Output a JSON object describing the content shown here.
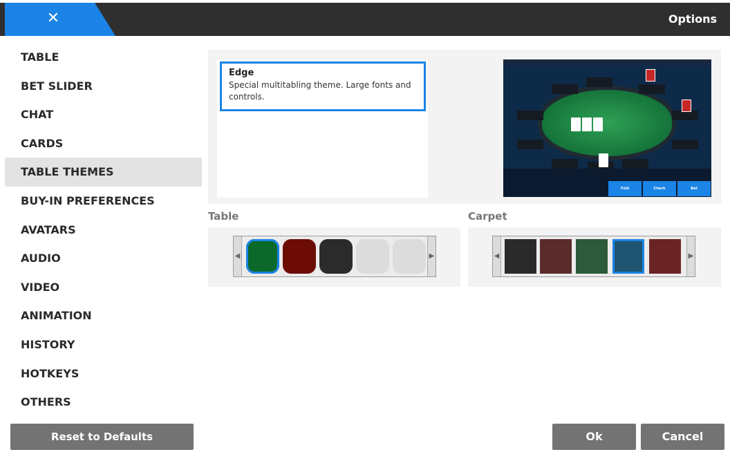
{
  "header": {
    "close_label": "✕",
    "title": "Options"
  },
  "sidebar": {
    "items": [
      {
        "label": "TABLE"
      },
      {
        "label": "BET SLIDER"
      },
      {
        "label": "CHAT"
      },
      {
        "label": "CARDS"
      },
      {
        "label": "TABLE THEMES",
        "active": true
      },
      {
        "label": "BUY-IN PREFERENCES"
      },
      {
        "label": "AVATARS"
      },
      {
        "label": "AUDIO"
      },
      {
        "label": "VIDEO"
      },
      {
        "label": "ANIMATION"
      },
      {
        "label": "HISTORY"
      },
      {
        "label": "HOTKEYS"
      },
      {
        "label": "OTHERS"
      }
    ],
    "reset_label": "Reset to Defaults"
  },
  "themes": {
    "selected": {
      "name": "Edge",
      "description": "Special multitabling theme. Large fonts and controls."
    }
  },
  "preview": {
    "buttons": [
      "Fold",
      "Check",
      "Bet"
    ]
  },
  "table_picker": {
    "label": "Table",
    "swatches": [
      "#0b6a2a",
      "#6d0c05",
      "#2b2b2b",
      "#dcdcdc",
      "#dcdcdc"
    ],
    "selected_index": 0
  },
  "carpet_picker": {
    "label": "Carpet",
    "swatches": [
      "#2a2a2a",
      "#5a2b2b",
      "#2c5a3a",
      "#1f5470",
      "#6a2424"
    ],
    "selected_index": 3
  },
  "footer": {
    "ok_label": "Ok",
    "cancel_label": "Cancel"
  },
  "colors": {
    "accent": "#1b84e6",
    "topbar": "#2f2f2f",
    "button": "#737373"
  }
}
